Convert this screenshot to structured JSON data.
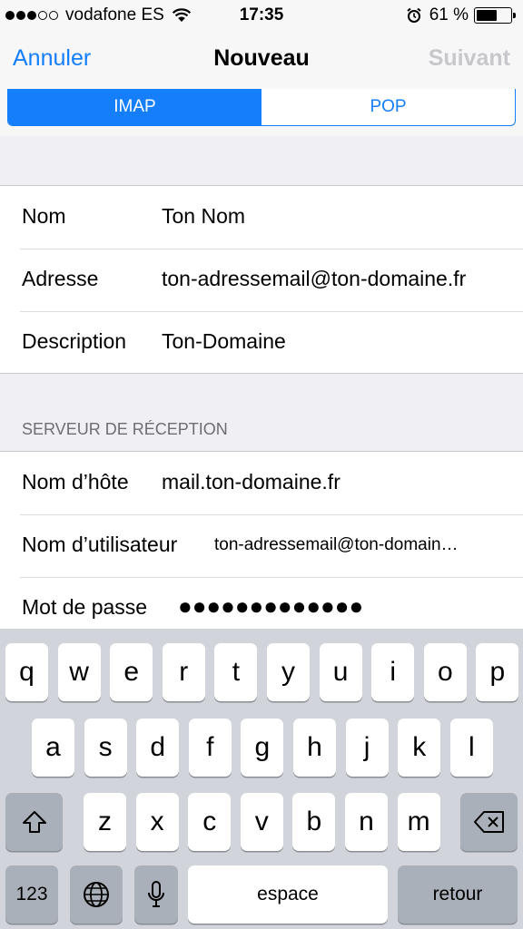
{
  "status_bar": {
    "carrier": "vodafone ES",
    "time": "17:35",
    "battery_percent": "61 %",
    "battery_level": 0.61,
    "signal_bars": 3,
    "icons": [
      "signal-dots-icon",
      "wifi-icon",
      "alarm-icon",
      "battery-icon"
    ]
  },
  "nav": {
    "cancel_label": "Annuler",
    "title": "Nouveau",
    "next_label": "Suivant"
  },
  "segmented": {
    "options": [
      "IMAP",
      "POP"
    ],
    "selected": "IMAP"
  },
  "account": {
    "rows": [
      {
        "label": "Nom",
        "value": "Ton Nom"
      },
      {
        "label": "Adresse",
        "value": "ton-adressemail@ton-domaine.fr"
      },
      {
        "label": "Description",
        "value": "Ton-Domaine"
      }
    ]
  },
  "incoming": {
    "header": "SERVEUR DE RÉCEPTION",
    "rows": [
      {
        "label": "Nom d’hôte",
        "value": "mail.ton-domaine.fr"
      },
      {
        "label": "Nom d’utilisateur",
        "value": "ton-adressemail@ton-domain…"
      },
      {
        "label": "Mot de passe",
        "value": "●●●●●●●●●●●●●"
      }
    ]
  },
  "keyboard": {
    "row1": [
      "q",
      "w",
      "e",
      "r",
      "t",
      "y",
      "u",
      "i",
      "o",
      "p"
    ],
    "row2": [
      "a",
      "s",
      "d",
      "f",
      "g",
      "h",
      "j",
      "k",
      "l"
    ],
    "row3": [
      "z",
      "x",
      "c",
      "v",
      "b",
      "n",
      "m"
    ],
    "numbers_label": "123",
    "space_label": "espace",
    "return_label": "retour"
  },
  "colors": {
    "accent": "#157efb",
    "disabled": "#c7c7cc",
    "background": "#efeff4",
    "keyboard_bg": "#d1d5db"
  }
}
